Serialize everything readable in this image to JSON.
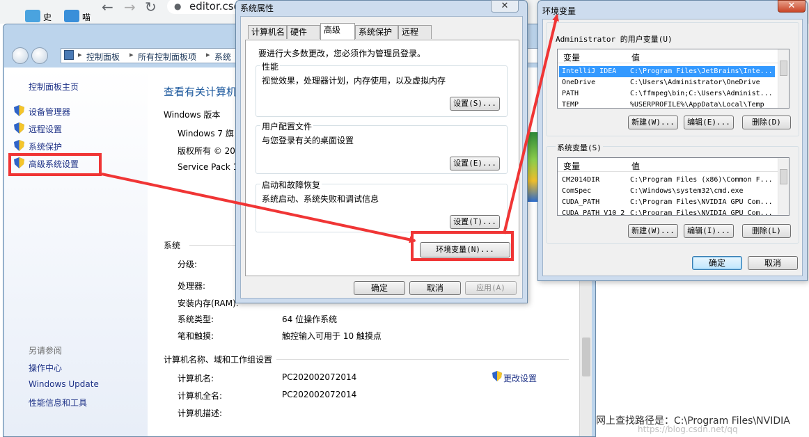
{
  "browser": {
    "tab_labels": [
      "史",
      "喵"
    ],
    "url": "editor.csd"
  },
  "control_panel": {
    "breadcrumb": [
      "控制面板",
      "所有控制面板项",
      "系统"
    ],
    "left_nav": {
      "home": "控制面板主页",
      "links": [
        "设备管理器",
        "远程设置",
        "系统保护",
        "高级系统设置"
      ],
      "see_also_heading": "另请参阅",
      "see_also": [
        "操作中心",
        "Windows Update",
        "性能信息和工具"
      ]
    },
    "main": {
      "heading": "查看有关计算机",
      "windows_edition_heading": "Windows 版本",
      "edition": "Windows 7 旗",
      "copyright": "版权所有 © 20",
      "service_pack": "Service Pack 1",
      "system_heading": "系统",
      "system_rows": [
        {
          "label": "分级:",
          "value": ""
        },
        {
          "label": "处理器:",
          "value": ""
        },
        {
          "label": "安装内存(RAM):",
          "value": ""
        },
        {
          "label": "系统类型:",
          "value": "64 位操作系统"
        },
        {
          "label": "笔和触摸:",
          "value": "触控输入可用于 10 触摸点"
        }
      ],
      "computer_heading": "计算机名称、域和工作组设置",
      "change_settings": "更改设置",
      "computer_rows": [
        {
          "label": "计算机名:",
          "value": "PC202002072014"
        },
        {
          "label": "计算机全名:",
          "value": "PC202002072014"
        },
        {
          "label": "计算机描述:",
          "value": ""
        }
      ]
    }
  },
  "system_properties": {
    "title": "系统属性",
    "close": "✕",
    "tabs": [
      "计算机名",
      "硬件",
      "高级",
      "系统保护",
      "远程"
    ],
    "admin_note": "要进行大多数更改，您必须作为管理员登录。",
    "groups": [
      {
        "title": "性能",
        "desc": "视觉效果，处理器计划，内存使用，以及虚拟内存",
        "button": "设置(S)..."
      },
      {
        "title": "用户配置文件",
        "desc": "与您登录有关的桌面设置",
        "button": "设置(E)..."
      },
      {
        "title": "启动和故障恢复",
        "desc": "系统启动、系统失败和调试信息",
        "button": "设置(T)..."
      }
    ],
    "env_button": "环境变量(N)...",
    "ok": "确定",
    "cancel": "取消",
    "apply": "应用(A)"
  },
  "env_vars": {
    "title": "环境变量",
    "close": "✕",
    "user_section_label": "Administrator 的用户变量(U)",
    "system_section_label": "系统变量(S)",
    "col_var": "变量",
    "col_val": "值",
    "user_vars": [
      {
        "name": "IntelliJ IDEA",
        "value": "C:\\Program Files\\JetBrains\\Inte..."
      },
      {
        "name": "OneDrive",
        "value": "C:\\Users\\Administrator\\OneDrive"
      },
      {
        "name": "PATH",
        "value": "C:\\ffmpeg\\bin;C:\\Users\\Administ..."
      },
      {
        "name": "TEMP",
        "value": "%USERPROFILE%\\AppData\\Local\\Temp"
      }
    ],
    "system_vars": [
      {
        "name": "CM2014DIR",
        "value": "C:\\Program Files (x86)\\Common F..."
      },
      {
        "name": "ComSpec",
        "value": "C:\\Windows\\system32\\cmd.exe"
      },
      {
        "name": "CUDA_PATH",
        "value": "C:\\Program Files\\NVIDIA GPU Com..."
      },
      {
        "name": "CUDA_PATH_V10_2",
        "value": "C:\\Program Files\\NVIDIA GPU Com..."
      }
    ],
    "user_buttons": [
      "新建(W)...",
      "编辑(E)...",
      "删除(D)"
    ],
    "system_buttons": [
      "新建(W)...",
      "编辑(I)...",
      "删除(L)"
    ],
    "ok": "确定",
    "cancel": "取消"
  },
  "caption": {
    "text": "网上查找路径是：C:\\Program Files\\NVIDIA",
    "watermark": "https://blog.csdn.net/qq"
  },
  "colors": {
    "annotation_red": "#f03535",
    "link_blue": "#1e3287",
    "selection_blue": "#3399ff"
  }
}
